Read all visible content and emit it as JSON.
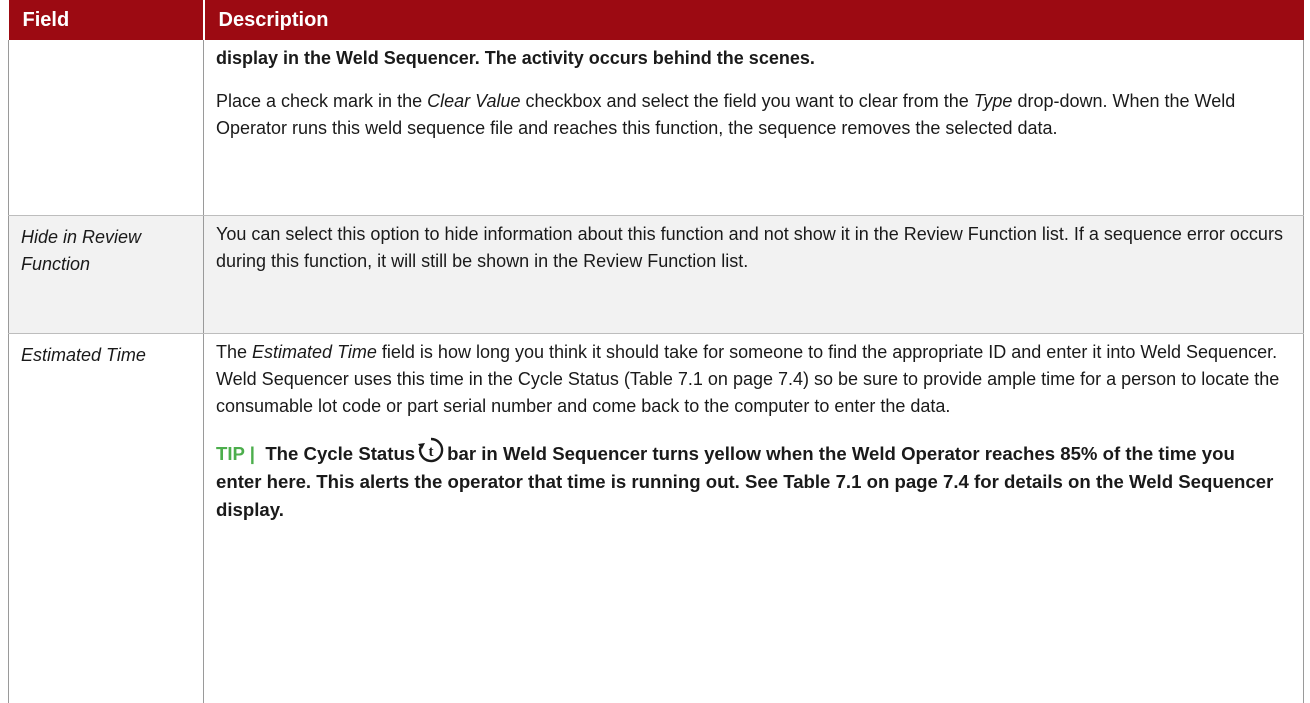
{
  "header": {
    "field": "Field",
    "description": "Description"
  },
  "rows": [
    {
      "field": "",
      "desc_bold": "display in the Weld Sequencer.  The activity occurs behind the scenes.",
      "desc_p2_a": "Place a check mark in the ",
      "desc_p2_b": "Clear Value",
      "desc_p2_c": " checkbox and select the field you want to clear from the ",
      "desc_p2_d": "Type",
      "desc_p2_e": " drop-down.  When the Weld Operator runs this weld sequence file and reaches this function, the sequence removes the selected data."
    },
    {
      "field": "Hide in Review Function",
      "desc": "You can select this option to hide information about this function and not show it in the Review Function list.  If a sequence error occurs during this function, it will still be shown in the Review Function list."
    },
    {
      "field": "Estimated Time",
      "desc_p1_a": "The ",
      "desc_p1_b": "Estimated Time",
      "desc_p1_c": " field is how long you think it should take for someone to find the appropriate ID and enter it into Weld Sequencer.  Weld Sequencer uses this time in the Cycle Status (Table 7.1 on page 7.4) so be sure to provide ample time for a person to locate the consumable lot code or part serial number and come back to the computer to enter the data.",
      "tip_label": "TIP  |",
      "tip_a": "The Cycle Status",
      "tip_b": "bar in Weld Sequencer turns yellow when the Weld Operator reaches 85% of the time you enter here.  This alerts the operator that time is running out.  See Table 7.1 on page 7.4 for details on the Weld Sequencer display."
    }
  ],
  "colors": {
    "header_bg": "#9c0a12",
    "tip_label": "#4cae4c",
    "row_shade": "#f2f2f2"
  },
  "icons": {
    "cycle_status": "timer-t-icon"
  }
}
